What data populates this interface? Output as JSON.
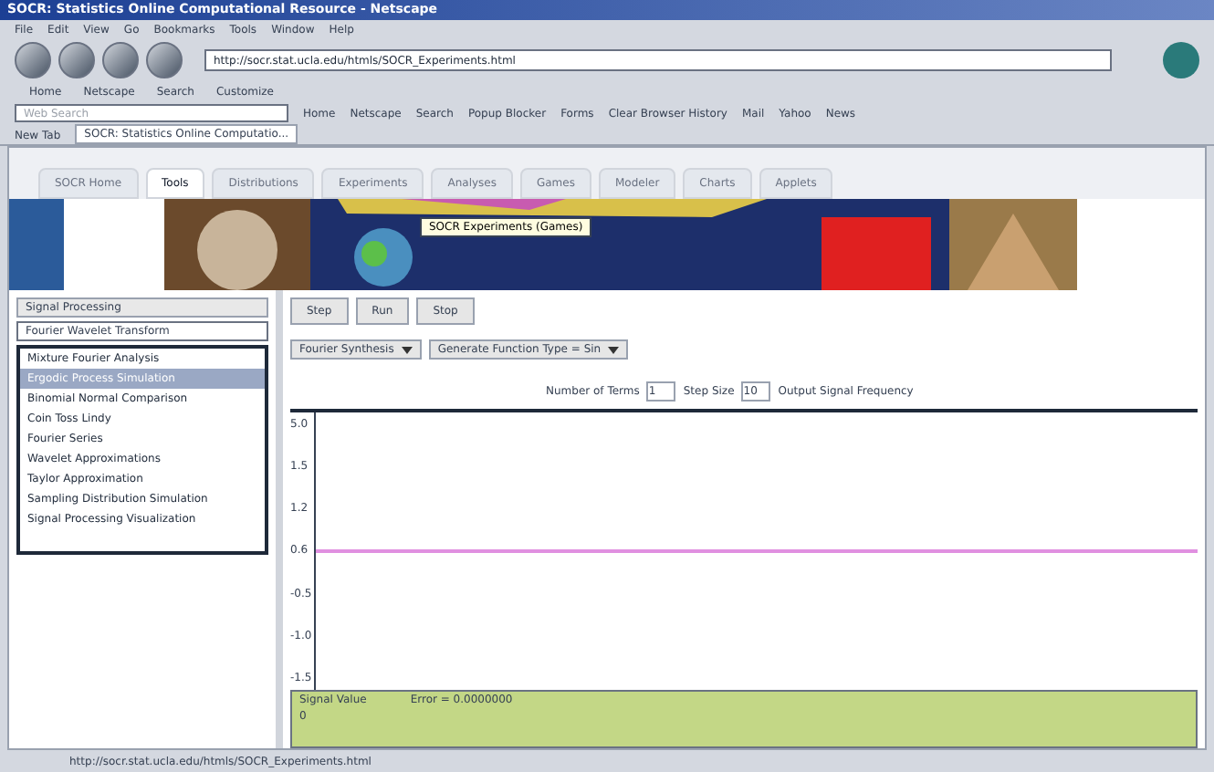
{
  "window": {
    "title": "SOCR: Statistics Online Computational Resource - Netscape"
  },
  "menu": [
    "File",
    "Edit",
    "View",
    "Go",
    "Bookmarks",
    "Tools",
    "Window",
    "Help"
  ],
  "address": {
    "value": "http://socr.stat.ucla.edu/htmls/SOCR_Experiments.html"
  },
  "bookmarks": [
    "Home",
    "Netscape",
    "Search",
    "Customize"
  ],
  "toolbar": {
    "search_placeholder": "Web Search",
    "items": [
      "Home",
      "Netscape",
      "Search",
      "Popup Blocker",
      "Forms",
      "Clear Browser History",
      "Mail",
      "Yahoo",
      "News"
    ]
  },
  "browser_tabs": [
    {
      "label": "New Tab",
      "selected": false
    },
    {
      "label": "SOCR: Statistics Online Computatio...",
      "selected": true
    }
  ],
  "socr_tabs": [
    {
      "label": "SOCR Home",
      "selected": false
    },
    {
      "label": "Tools",
      "selected": true
    },
    {
      "label": "Distributions",
      "selected": false
    },
    {
      "label": "Experiments",
      "selected": false
    },
    {
      "label": "Analyses",
      "selected": false
    },
    {
      "label": "Games",
      "selected": false
    },
    {
      "label": "Modeler",
      "selected": false
    },
    {
      "label": "Charts",
      "selected": false
    },
    {
      "label": "Applets",
      "selected": false
    }
  ],
  "banner": {
    "tooltip": "SOCR Experiments (Games)"
  },
  "left_panel": {
    "heading": "Signal Processing",
    "dropdown": "Fourier Wavelet Transform",
    "items": [
      {
        "label": "Mixture Fourier Analysis",
        "selected": false
      },
      {
        "label": "Ergodic Process Simulation",
        "selected": true
      },
      {
        "label": "Binomial Normal Comparison",
        "selected": false
      },
      {
        "label": "Coin Toss Lindy",
        "selected": false
      },
      {
        "label": "Fourier Series",
        "selected": false
      },
      {
        "label": "Wavelet Approximations",
        "selected": false
      },
      {
        "label": "Taylor Approximation",
        "selected": false
      },
      {
        "label": "Sampling Distribution Simulation",
        "selected": false
      },
      {
        "label": "Signal Processing Visualization",
        "selected": false
      }
    ]
  },
  "controls": {
    "buttons": [
      "Step",
      "Run",
      "Stop"
    ],
    "selects": [
      "Fourier Synthesis",
      "Generate Function Type = Sin"
    ],
    "params": {
      "label1": "Number of Terms",
      "value1": "1",
      "label2": "Step Size",
      "value2": "10",
      "label3": "Output Signal Frequency"
    }
  },
  "chart": {
    "yticks": [
      "5.0",
      "1.5",
      "1.2",
      "0.6",
      "-0.5",
      "-1.0",
      "-1.5"
    ]
  },
  "output": {
    "lines": [
      "Signal Value",
      "Error = 0.0000000"
    ],
    "extra": "0"
  },
  "status_bar": {
    "text": "http://socr.stat.ucla.edu/htmls/SOCR_Experiments.html"
  }
}
